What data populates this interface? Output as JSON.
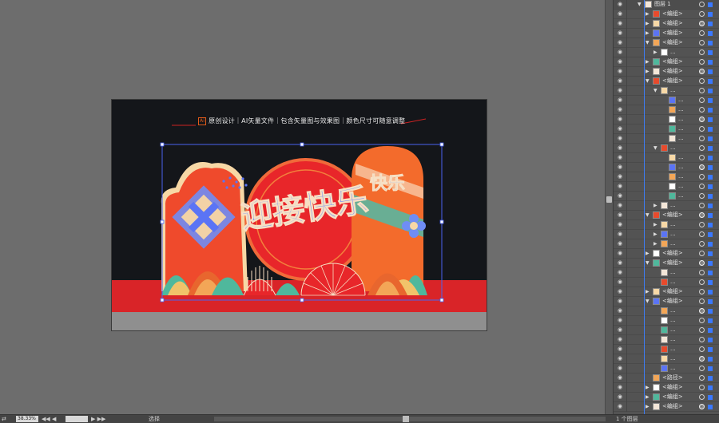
{
  "artboard": {
    "tagline_badge": "Ai",
    "tagline": "原创设计｜AI矢量文件｜包含矢量图与效果图｜颜色尺寸可随意调整",
    "main_calligraphy": "迎接快乐",
    "side_calligraphy": "快乐",
    "colors": {
      "bg": "#14161a",
      "red": "#e0262b",
      "orange": "#f36b2c",
      "blue": "#4a63f0",
      "teal": "#44c1a7"
    }
  },
  "layers_panel": {
    "rows": [
      {
        "label": "图层 1",
        "indent": 0,
        "tri": "down",
        "top": true
      },
      {
        "label": "<编组>",
        "indent": 1,
        "tri": "right"
      },
      {
        "label": "<编组>",
        "indent": 1,
        "tri": "right"
      },
      {
        "label": "<编组>",
        "indent": 1,
        "tri": "right"
      },
      {
        "label": "<编组>",
        "indent": 1,
        "tri": "down"
      },
      {
        "label": "...",
        "indent": 2,
        "tri": "right"
      },
      {
        "label": "<编组>",
        "indent": 1,
        "tri": "right"
      },
      {
        "label": "<编组>",
        "indent": 1,
        "tri": "right"
      },
      {
        "label": "<编组>",
        "indent": 1,
        "tri": "down"
      },
      {
        "label": "...",
        "indent": 2,
        "tri": "down"
      },
      {
        "label": "...",
        "indent": 3,
        "tri": ""
      },
      {
        "label": "...",
        "indent": 3,
        "tri": ""
      },
      {
        "label": "...",
        "indent": 3,
        "tri": ""
      },
      {
        "label": "...",
        "indent": 3,
        "tri": ""
      },
      {
        "label": "...",
        "indent": 3,
        "tri": ""
      },
      {
        "label": "...",
        "indent": 2,
        "tri": "down"
      },
      {
        "label": "...",
        "indent": 3,
        "tri": ""
      },
      {
        "label": "...",
        "indent": 3,
        "tri": ""
      },
      {
        "label": "...",
        "indent": 3,
        "tri": ""
      },
      {
        "label": "...",
        "indent": 3,
        "tri": ""
      },
      {
        "label": "...",
        "indent": 3,
        "tri": ""
      },
      {
        "label": "...",
        "indent": 2,
        "tri": "right"
      },
      {
        "label": "<编组>",
        "indent": 1,
        "tri": "down"
      },
      {
        "label": "...",
        "indent": 2,
        "tri": "right"
      },
      {
        "label": "...",
        "indent": 2,
        "tri": "right"
      },
      {
        "label": "...",
        "indent": 2,
        "tri": "right"
      },
      {
        "label": "<编组>",
        "indent": 1,
        "tri": "right"
      },
      {
        "label": "<编组>",
        "indent": 1,
        "tri": "down"
      },
      {
        "label": "...",
        "indent": 2,
        "tri": ""
      },
      {
        "label": "...",
        "indent": 2,
        "tri": ""
      },
      {
        "label": "<编组>",
        "indent": 1,
        "tri": "right"
      },
      {
        "label": "<编组>",
        "indent": 1,
        "tri": "down"
      },
      {
        "label": "...",
        "indent": 2,
        "tri": ""
      },
      {
        "label": "...",
        "indent": 2,
        "tri": ""
      },
      {
        "label": "...",
        "indent": 2,
        "tri": ""
      },
      {
        "label": "...",
        "indent": 2,
        "tri": ""
      },
      {
        "label": "...",
        "indent": 2,
        "tri": ""
      },
      {
        "label": "...",
        "indent": 2,
        "tri": ""
      },
      {
        "label": "...",
        "indent": 2,
        "tri": ""
      },
      {
        "label": "<路径>",
        "indent": 1,
        "tri": ""
      },
      {
        "label": "<编组>",
        "indent": 1,
        "tri": "right"
      },
      {
        "label": "<编组>",
        "indent": 1,
        "tri": "right"
      },
      {
        "label": "<编组>",
        "indent": 1,
        "tri": "right"
      }
    ]
  },
  "status_bar": {
    "zoom": "38.33%",
    "nav_left": "◀◀ ◀",
    "nav_right": "▶ ▶▶",
    "tool": "选择",
    "layer_count": "1 个图层"
  }
}
